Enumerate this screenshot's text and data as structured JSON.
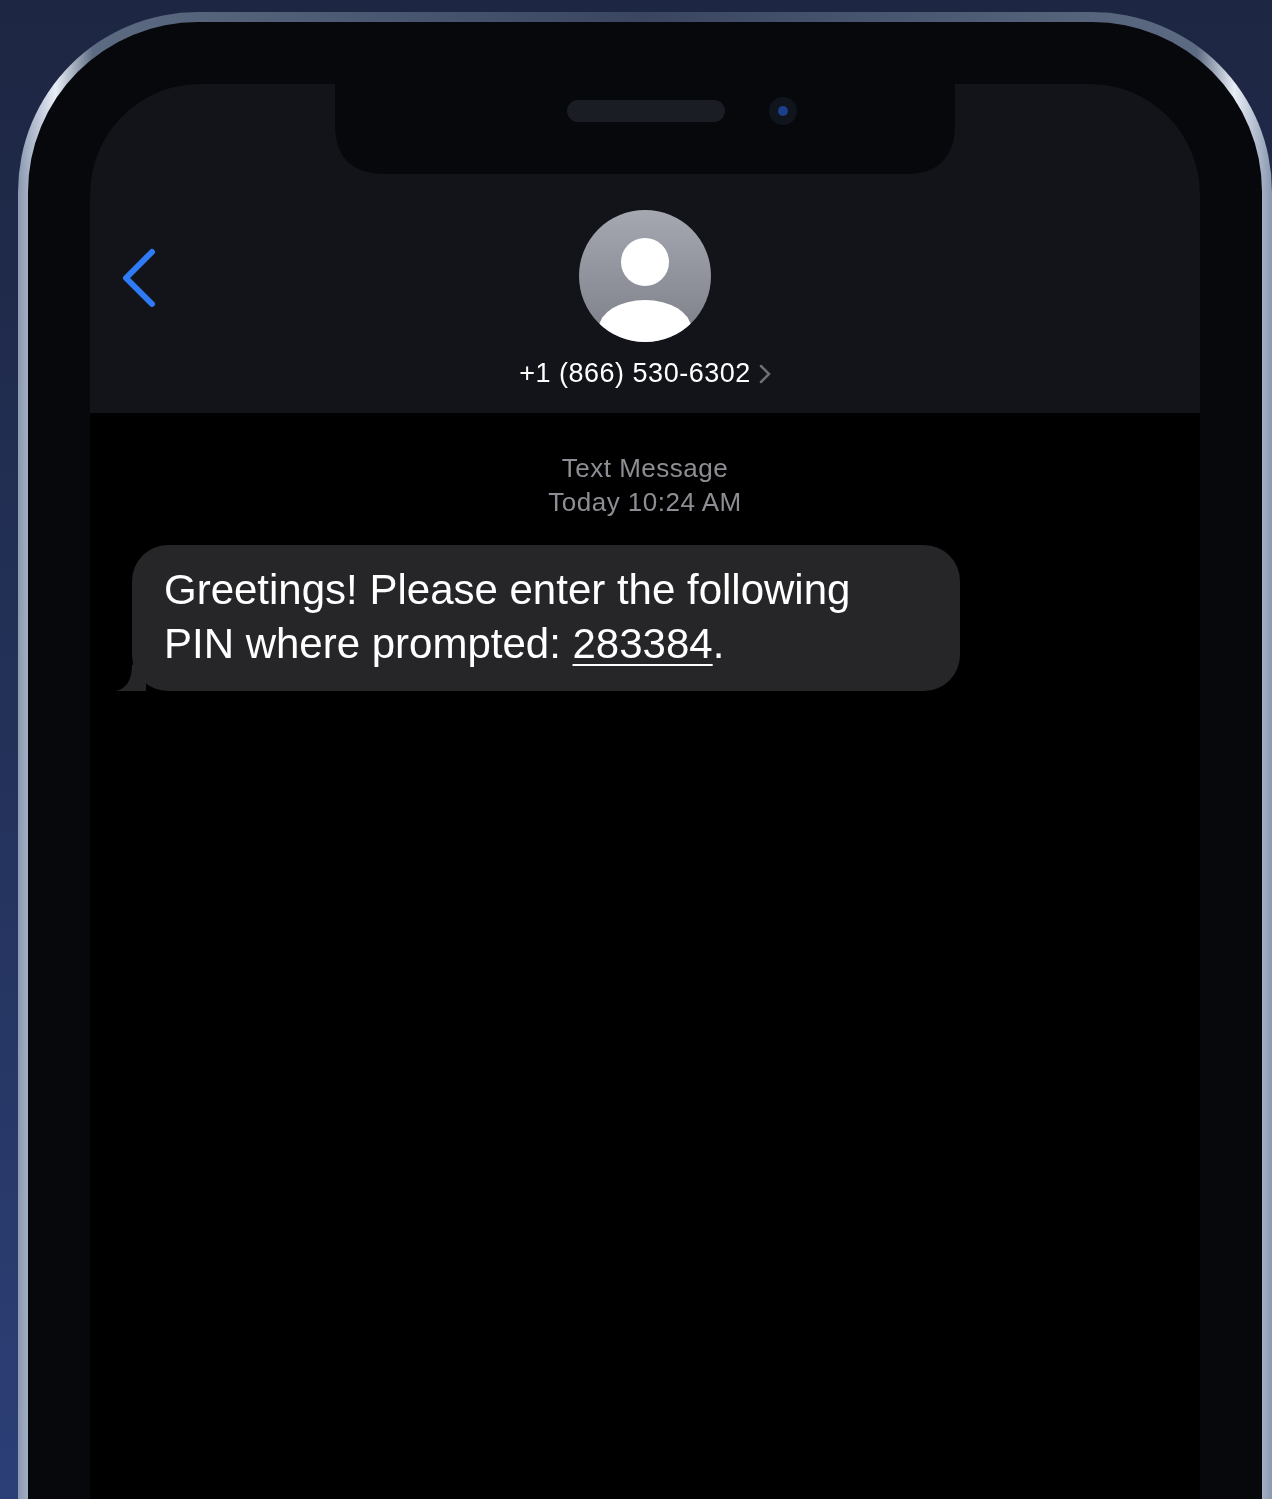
{
  "contact": {
    "phone_number": "+1 (866) 530-6302"
  },
  "conversation": {
    "service_label": "Text Message",
    "timestamp": "Today 10:24 AM",
    "messages": [
      {
        "kind": "incoming",
        "text_before": "Greetings! Please enter the following PIN where prompted: ",
        "link": "283384",
        "text_after": "."
      }
    ]
  }
}
